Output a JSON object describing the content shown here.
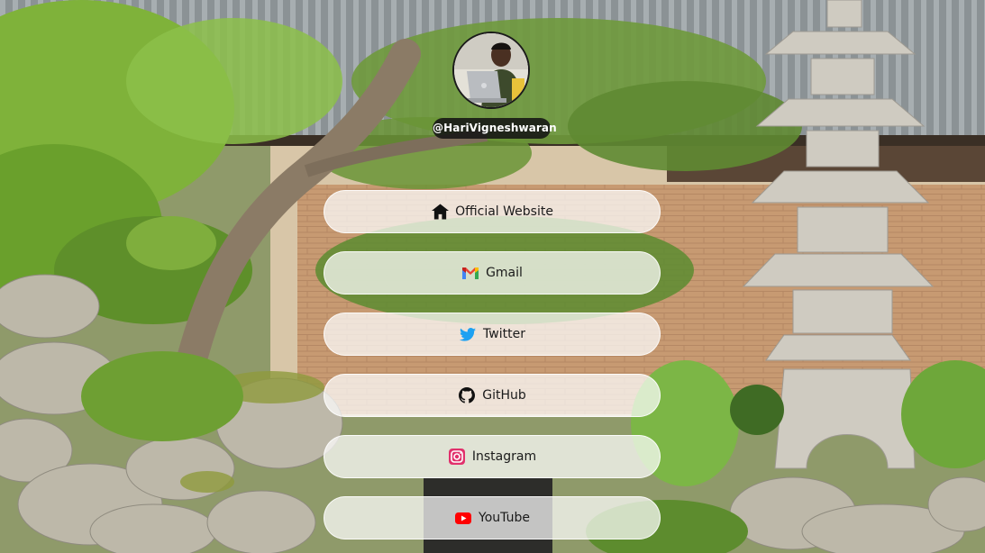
{
  "profile": {
    "handle": "@HariVigneshwaran",
    "avatar_icon": "person-with-laptop"
  },
  "links": [
    {
      "label": "Official Website",
      "icon": "home-icon",
      "color": "#111111"
    },
    {
      "label": "Gmail",
      "icon": "gmail-icon",
      "color": "#EA4335"
    },
    {
      "label": "Twitter",
      "icon": "twitter-icon",
      "color": "#1DA1F2"
    },
    {
      "label": "GitHub",
      "icon": "github-icon",
      "color": "#111111"
    },
    {
      "label": "Instagram",
      "icon": "instagram-icon",
      "color": "#E1306C"
    },
    {
      "label": "YouTube",
      "icon": "youtube-icon",
      "color": "#FF0000"
    }
  ]
}
